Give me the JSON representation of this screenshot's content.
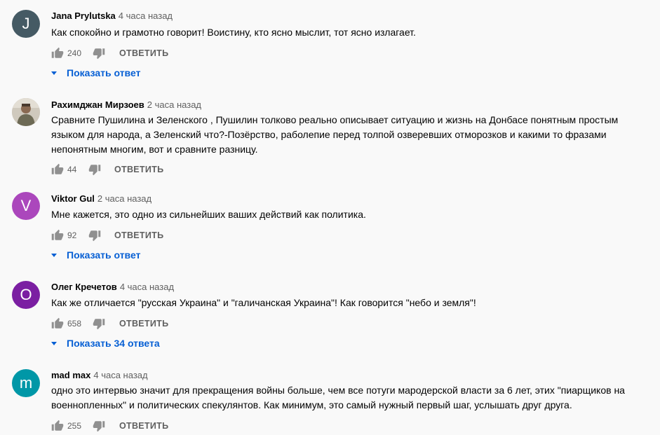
{
  "reply_label": "ОТВЕТИТЬ",
  "colors": {
    "link": "#065fd4",
    "meta": "#606060"
  },
  "comments": [
    {
      "author": "Jana Prylutska",
      "time": "4 часа назад",
      "avatar_letter": "J",
      "avatar_color": "#455a64",
      "text": "Как спокойно и грамотно говорит! Воистину, кто ясно мыслит, тот ясно излагает.",
      "likes": "240",
      "replies_label": "Показать ответ"
    },
    {
      "author": "Рахимджан Мирзоев",
      "time": "2 часа назад",
      "avatar_letter": "",
      "avatar_color": "#c9c3b8",
      "text": "Сравните Пушилина и Зеленского , Пушилин толково реально описывает ситуацию и жизнь на Донбасе понятным простым языком для народа, а Зеленский что?-Позёрство, раболепие перед толпой озверевших отморозков и какими то фразами непонятным многим, вот и сравните разницу.",
      "likes": "44",
      "replies_label": ""
    },
    {
      "author": "Viktor Gul",
      "time": "2 часа назад",
      "avatar_letter": "V",
      "avatar_color": "#ab47bc",
      "text": "Мне кажется, это одно из сильнейших ваших действий как политика.",
      "likes": "92",
      "replies_label": "Показать ответ"
    },
    {
      "author": "Олег Кречетов",
      "time": "4 часа назад",
      "avatar_letter": "О",
      "avatar_color": "#7b1fa2",
      "text": "Как же отличается \"русская Украина\" и \"галичанская Украина\"! Как говорится \"небо и земля\"!",
      "likes": "658",
      "replies_label": "Показать 34 ответа"
    },
    {
      "author": "mad max",
      "time": "4 часа назад",
      "avatar_letter": "m",
      "avatar_color": "#0097a7",
      "text": "одно это интервью значит для прекращения войны больше, чем все потуги мародерской власти за 6 лет, этих \"пиарщиков на военнопленных\" и политических спекулянтов. Как минимум, это самый нужный первый шаг, услышать друг друга.",
      "likes": "255",
      "replies_label": ""
    }
  ]
}
